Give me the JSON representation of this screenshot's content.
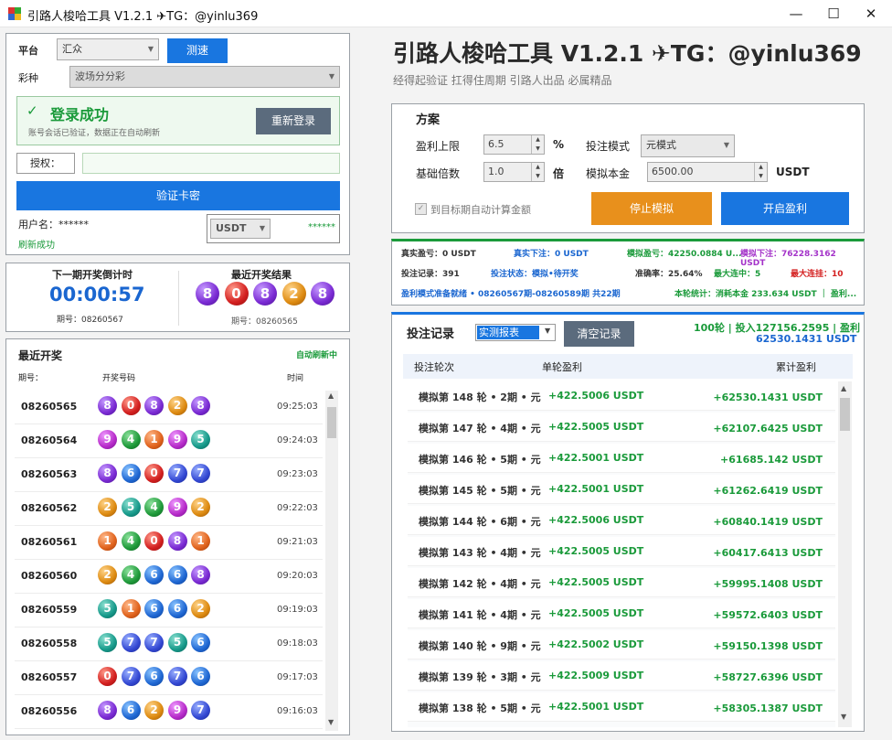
{
  "window": {
    "title": "引路人梭哈工具 V1.2.1 ✈TG：@yinlu369",
    "min": "—",
    "max": "☐",
    "close": "✕"
  },
  "left": {
    "platform_label": "平台",
    "platform_value": "汇众",
    "speed_btn": "测速",
    "lottery_label": "彩种",
    "lottery_value": "波场分分彩",
    "login_title": "登录成功",
    "login_check": "✓",
    "login_sub": "账号会话已验证，数据正在自动刷新",
    "relogin_btn": "重新登录",
    "auth_label": "授权：",
    "auth_value": "",
    "verify_btn": "验证卡密",
    "user_label": "用户名：******",
    "currency": "USDT",
    "balance_mask": "******",
    "refresh_status": "刷新成功"
  },
  "countdown": {
    "title": "下一期开奖倒计时",
    "time": "00:00:57",
    "period_label": "期号：08260567",
    "last_title": "最近开奖结果",
    "last_numbers": [
      8,
      0,
      8,
      2,
      8
    ],
    "last_period": "期号：08260565"
  },
  "history": {
    "title": "最近开奖",
    "auto": "自动刷新中",
    "col_period": "期号：",
    "col_numbers": "开奖号码",
    "col_time": "时间",
    "rows": [
      {
        "period": "08260565",
        "numbers": [
          8,
          0,
          8,
          2,
          8
        ],
        "time": "09:25:03"
      },
      {
        "period": "08260564",
        "numbers": [
          9,
          4,
          1,
          9,
          5
        ],
        "time": "09:24:03"
      },
      {
        "period": "08260563",
        "numbers": [
          8,
          6,
          0,
          7,
          7
        ],
        "time": "09:23:03"
      },
      {
        "period": "08260562",
        "numbers": [
          2,
          5,
          4,
          9,
          2
        ],
        "time": "09:22:03"
      },
      {
        "period": "08260561",
        "numbers": [
          1,
          4,
          0,
          8,
          1
        ],
        "time": "09:21:03"
      },
      {
        "period": "08260560",
        "numbers": [
          2,
          4,
          6,
          6,
          8
        ],
        "time": "09:20:03"
      },
      {
        "period": "08260559",
        "numbers": [
          5,
          1,
          6,
          6,
          2
        ],
        "time": "09:19:03"
      },
      {
        "period": "08260558",
        "numbers": [
          5,
          7,
          7,
          5,
          6
        ],
        "time": "09:18:03"
      },
      {
        "period": "08260557",
        "numbers": [
          0,
          7,
          6,
          7,
          6
        ],
        "time": "09:17:03"
      },
      {
        "period": "08260556",
        "numbers": [
          8,
          6,
          2,
          9,
          7
        ],
        "time": "09:16:03"
      }
    ]
  },
  "header": {
    "title": "引路人梭哈工具 V1.2.1 ✈TG：@yinlu369",
    "subtitle": "经得起验证 扛得住周期 引路人出品 必属精品"
  },
  "plan": {
    "title": "方案",
    "profit_cap_label": "盈利上限",
    "profit_cap_value": "6.5",
    "percent": "%",
    "bet_mode_label": "投注模式",
    "bet_mode_value": "元模式",
    "base_mult_label": "基础倍数",
    "base_mult_value": "1.0",
    "mult_unit": "倍",
    "sim_capital_label": "模拟本金",
    "sim_capital_value": "6500.00",
    "sim_capital_unit": "USDT",
    "auto_calc_label": "到目标期自动计算金额",
    "stop_btn": "停止模拟",
    "start_btn": "开启盈利"
  },
  "stats": {
    "real_profit": "真实盈亏：0 USDT",
    "real_bet": "真实下注：0 USDT",
    "sim_profit": "模拟盈亏：42250.0884 U...",
    "sim_bet": "模拟下注：76228.3162 USDT",
    "bet_records": "投注记录：391",
    "bet_status": "投注状态：模拟•待开奖",
    "accuracy": "准确率：25.64%",
    "max_win": "最大连中：5",
    "max_loss": "最大连挂：10",
    "ready": "盈利模式准备就绪 • 08260567期-08260589期 共22期",
    "round_stats": "本轮统计：消耗本金 233.634 USDT ｜ 盈利..."
  },
  "records": {
    "title": "投注记录",
    "report_value": "实测报表",
    "clear_btn": "清空记录",
    "summary_line1": "100轮 | 投入127156.2595 | 盈利",
    "summary_line2": "62530.1431 USDT",
    "col_round": "投注轮次",
    "col_profit": "单轮盈利",
    "col_total": "累计盈利",
    "rows": [
      {
        "round": "模拟第 148 轮 • 2期 • 元",
        "profit": "+422.5006 USDT",
        "total": "+62530.1431 USDT"
      },
      {
        "round": "模拟第 147 轮 • 4期 • 元",
        "profit": "+422.5005 USDT",
        "total": "+62107.6425 USDT"
      },
      {
        "round": "模拟第 146 轮 • 5期 • 元",
        "profit": "+422.5001 USDT",
        "total": "+61685.142 USDT"
      },
      {
        "round": "模拟第 145 轮 • 5期 • 元",
        "profit": "+422.5001 USDT",
        "total": "+61262.6419 USDT"
      },
      {
        "round": "模拟第 144 轮 • 6期 • 元",
        "profit": "+422.5006 USDT",
        "total": "+60840.1419 USDT"
      },
      {
        "round": "模拟第 143 轮 • 4期 • 元",
        "profit": "+422.5005 USDT",
        "total": "+60417.6413 USDT"
      },
      {
        "round": "模拟第 142 轮 • 4期 • 元",
        "profit": "+422.5005 USDT",
        "total": "+59995.1408 USDT"
      },
      {
        "round": "模拟第 141 轮 • 4期 • 元",
        "profit": "+422.5005 USDT",
        "total": "+59572.6403 USDT"
      },
      {
        "round": "模拟第 140 轮 • 9期 • 元",
        "profit": "+422.5002 USDT",
        "total": "+59150.1398 USDT"
      },
      {
        "round": "模拟第 139 轮 • 3期 • 元",
        "profit": "+422.5009 USDT",
        "total": "+58727.6396 USDT"
      },
      {
        "round": "模拟第 138 轮 • 5期 • 元",
        "profit": "+422.5001 USDT",
        "total": "+58305.1387 USDT"
      }
    ]
  }
}
